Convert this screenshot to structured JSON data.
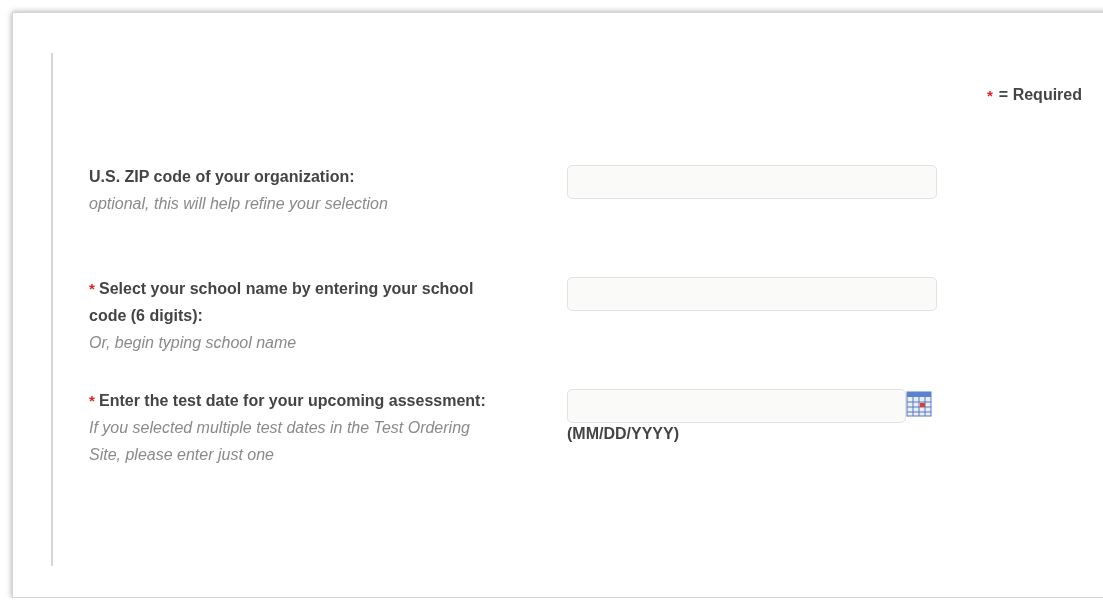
{
  "required_note": {
    "mark": "*",
    "text": "= Required"
  },
  "fields": [
    {
      "kind": "text",
      "required": false,
      "label": "U.S. ZIP code of your organization:",
      "hints": [
        "optional, this will help refine your selection"
      ]
    },
    {
      "kind": "text",
      "required": true,
      "label": "Select your school name by entering your school code (6 digits):",
      "hints": [
        "Or, begin typing school name"
      ]
    },
    {
      "kind": "date",
      "required": true,
      "label": "Enter the test date for your upcoming assessment:",
      "hints": [
        "If you selected multiple test dates in the Test Ordering Site, please enter just one"
      ],
      "format": "(MM/DD/YYYY)"
    }
  ]
}
